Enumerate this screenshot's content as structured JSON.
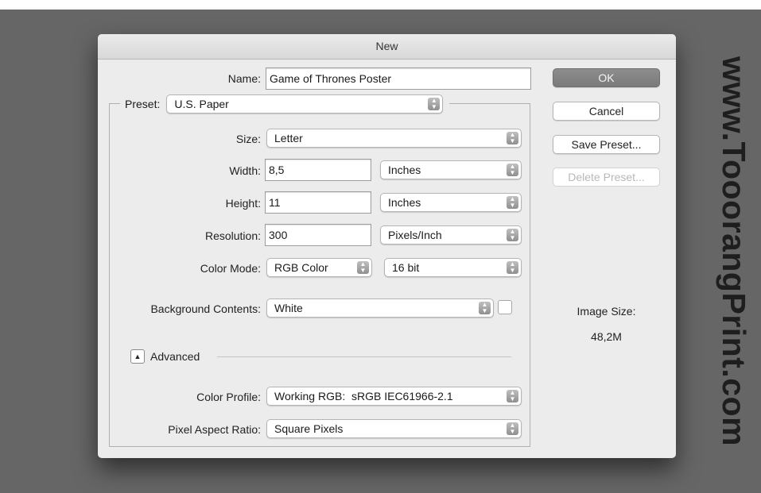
{
  "window": {
    "title": "New"
  },
  "form": {
    "name_label": "Name:",
    "name_value": "Game of Thrones Poster",
    "preset_label": "Preset:",
    "preset_value": "U.S. Paper",
    "size_label": "Size:",
    "size_value": "Letter",
    "width_label": "Width:",
    "width_value": "8,5",
    "width_unit": "Inches",
    "height_label": "Height:",
    "height_value": "11",
    "height_unit": "Inches",
    "resolution_label": "Resolution:",
    "resolution_value": "300",
    "resolution_unit": "Pixels/Inch",
    "color_mode_label": "Color Mode:",
    "color_mode_value": "RGB Color",
    "bit_depth_value": "16 bit",
    "background_label": "Background Contents:",
    "background_value": "White",
    "advanced_label": "Advanced",
    "color_profile_label": "Color Profile:",
    "color_profile_value": "Working RGB:  sRGB IEC61966-2.1",
    "pixel_aspect_label": "Pixel Aspect Ratio:",
    "pixel_aspect_value": "Square Pixels"
  },
  "buttons": {
    "ok": "OK",
    "cancel": "Cancel",
    "save_preset": "Save Preset...",
    "delete_preset": "Delete Preset..."
  },
  "image_size": {
    "label": "Image Size:",
    "value": "48,2M"
  },
  "watermark": "www.TooorangPrint.com",
  "icons": {
    "select_arrows": "updown-chevron-icon",
    "disclosure": "triangle-up-icon"
  },
  "colors": {
    "background": "#666666",
    "dialog": "#ececec",
    "ok_button": "#858585"
  }
}
